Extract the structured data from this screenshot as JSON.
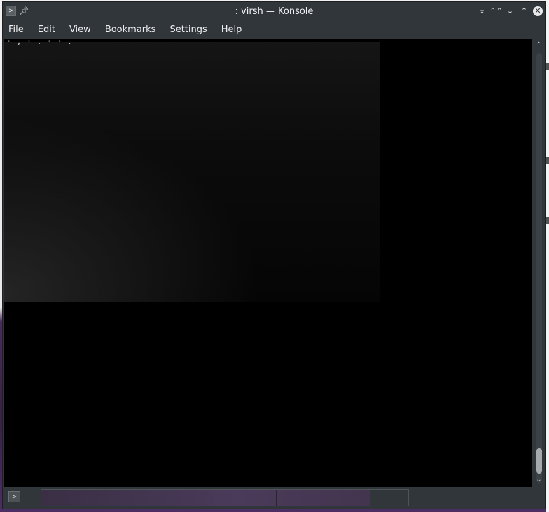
{
  "window": {
    "title": ": virsh — Konsole",
    "app_icon_glyph": ">",
    "pin_icon": "pin-icon",
    "controls": {
      "keep_above": "⌅",
      "shade": "⌃⌃",
      "minimize": "⌄",
      "maximize": "⌃",
      "close": "✕"
    }
  },
  "menubar": {
    "items": [
      "File",
      "Edit",
      "View",
      "Bookmarks",
      "Settings",
      "Help"
    ]
  },
  "terminal": {
    "first_line": "· , · . · · ."
  },
  "scrollbar": {
    "up_arrow": "⌃",
    "down_arrow": "⌄"
  },
  "tabbar": {
    "new_tab_glyph": ">"
  },
  "colors": {
    "chrome": "#31363b",
    "text": "#eff0f1",
    "terminal_bg": "#000000",
    "tab_active": "#4a3b5a"
  }
}
